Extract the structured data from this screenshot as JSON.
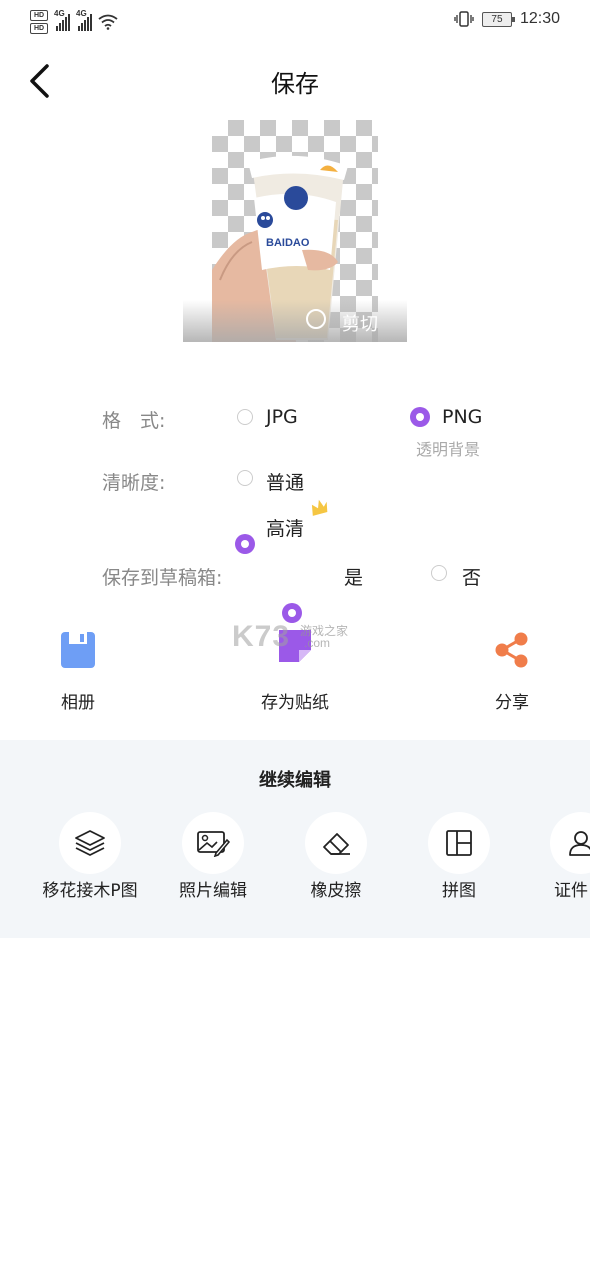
{
  "status_bar": {
    "hd1": "HD",
    "hd2": "HD",
    "net1": "4G",
    "net2": "4G",
    "battery": "75",
    "time": "12:30"
  },
  "header": {
    "title": "保存"
  },
  "preview": {
    "cup_text": "BAIDAO",
    "cut_label": "剪切"
  },
  "options": {
    "format": {
      "label": "格　式:",
      "choices": [
        {
          "label": "JPG",
          "selected": false
        },
        {
          "label": "PNG",
          "selected": true,
          "note": "透明背景"
        }
      ]
    },
    "clarity": {
      "label": "清晰度:",
      "choices": [
        {
          "label": "普通",
          "selected": false
        },
        {
          "label": "高清",
          "selected": true,
          "badge": "crown-icon"
        }
      ]
    },
    "save_draft": {
      "label": "保存到草稿箱:",
      "choices": [
        {
          "label": "是",
          "selected": true
        },
        {
          "label": "否",
          "selected": false
        }
      ]
    }
  },
  "actions": [
    {
      "label": "相册",
      "icon": "save-icon",
      "color": "#6e9ef5"
    },
    {
      "label": "存为贴纸",
      "icon": "sticker-icon",
      "color": "#9b59e8"
    },
    {
      "label": "分享",
      "icon": "share-icon",
      "color": "#f07d4a"
    }
  ],
  "continue_edit": {
    "title": "继续编辑",
    "tools": [
      {
        "label": "移花接木P图",
        "icon": "layers-icon"
      },
      {
        "label": "照片编辑",
        "icon": "photo-edit-icon"
      },
      {
        "label": "橡皮擦",
        "icon": "eraser-icon"
      },
      {
        "label": "拼图",
        "icon": "collage-icon"
      },
      {
        "label": "证件",
        "icon": "id-photo-icon"
      }
    ]
  },
  "watermark": {
    "brand": "K73",
    "site": "游戏之家",
    "domain": ".com"
  },
  "colors": {
    "accent": "#9b59e8",
    "panel": "#f3f6f9"
  }
}
